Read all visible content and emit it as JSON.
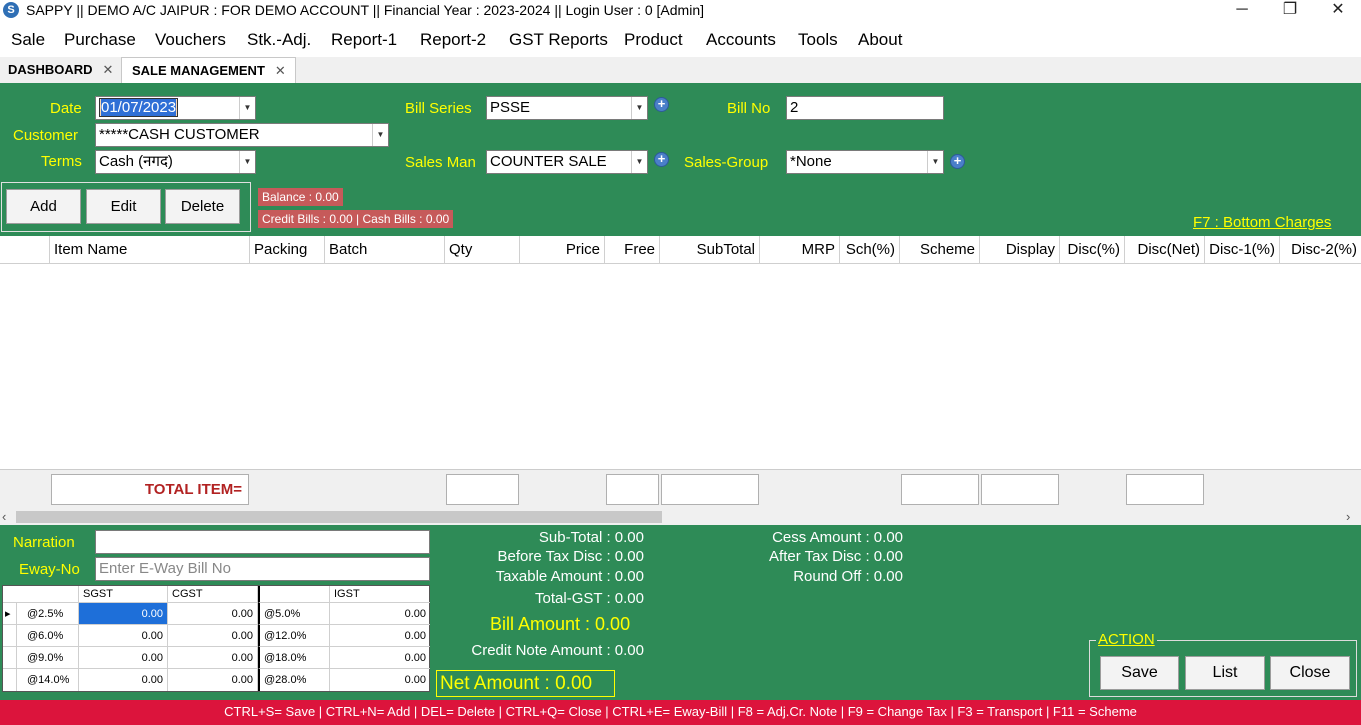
{
  "window": {
    "title": "SAPPY || DEMO A/C JAIPUR : FOR DEMO ACCOUNT || Financial Year : 2023-2024 || Login User : 0 [Admin]",
    "minimize": "─",
    "maximize": "❐",
    "close": "✕"
  },
  "menu": [
    "Sale",
    "Purchase",
    "Vouchers",
    "Stk.-Adj.",
    "Report-1",
    "Report-2",
    "GST Reports",
    "Product",
    "Accounts",
    "Tools",
    "About"
  ],
  "tabs": [
    {
      "label": "DASHBOARD",
      "close": "✕"
    },
    {
      "label": "SALE MANAGEMENT",
      "close": "✕"
    }
  ],
  "form": {
    "date_label": "Date",
    "date_value": "01/07/2023",
    "customer_label": "Customer",
    "customer_value": "*****CASH CUSTOMER",
    "terms_label": "Terms",
    "terms_value": "Cash (नगद)",
    "bill_series_label": "Bill Series",
    "bill_series_value": "PSSE",
    "sales_man_label": "Sales Man",
    "sales_man_value": "COUNTER SALE",
    "bill_no_label": "Bill No",
    "bill_no_value": "2",
    "sales_group_label": "Sales-Group",
    "sales_group_value": "*None"
  },
  "actions": {
    "add": "Add",
    "edit": "Edit",
    "delete": "Delete"
  },
  "balance": {
    "balance": "Balance : 0.00",
    "credit_cash": "Credit Bills : 0.00  | Cash Bills : 0.00"
  },
  "bottom_charges_link": "F7 : Bottom Charges",
  "grid": {
    "columns": [
      "",
      "Item Name",
      "Packing",
      "Batch",
      "Qty",
      "Price",
      "Free",
      "SubTotal",
      "MRP",
      "Sch(%)",
      "Scheme",
      "Display",
      "Disc(%)",
      "Disc(Net)",
      "Disc-1(%)",
      "Disc-2(%)"
    ],
    "total_item_label": "TOTAL ITEM="
  },
  "scroll": {
    "left": "‹",
    "right": "›"
  },
  "narration": {
    "label": "Narration",
    "value": ""
  },
  "eway": {
    "label": "Eway-No",
    "placeholder": "Enter E-Way Bill No"
  },
  "tax_table": {
    "headers": [
      "SGST",
      "CGST",
      "",
      "IGST"
    ],
    "rows": [
      {
        "marker": "▸",
        "rate": "@2.5%",
        "sgst": "0.00",
        "cgst": "0.00",
        "irate": "@5.0%",
        "igst": "0.00"
      },
      {
        "marker": "",
        "rate": "@6.0%",
        "sgst": "0.00",
        "cgst": "0.00",
        "irate": "@12.0%",
        "igst": "0.00"
      },
      {
        "marker": "",
        "rate": "@9.0%",
        "sgst": "0.00",
        "cgst": "0.00",
        "irate": "@18.0%",
        "igst": "0.00"
      },
      {
        "marker": "",
        "rate": "@14.0%",
        "sgst": "0.00",
        "cgst": "0.00",
        "irate": "@28.0%",
        "igst": "0.00"
      }
    ]
  },
  "summary": {
    "sub_total": "Sub-Total : 0.00",
    "before_tax_disc": "Before Tax Disc : 0.00",
    "taxable_amount": "Taxable Amount : 0.00",
    "total_gst": "Total-GST : 0.00",
    "bill_amount": "Bill Amount : 0.00",
    "credit_note_amount": "Credit Note Amount : 0.00",
    "net_amount": "Net Amount  : 0.00",
    "cess_amount": "Cess Amount : 0.00",
    "after_tax_disc": "After Tax Disc : 0.00",
    "round_off": "Round Off : 0.00"
  },
  "action_group": {
    "title": "ACTION",
    "save": "Save",
    "list": "List",
    "close": "Close"
  },
  "status": "CTRL+S= Save | CTRL+N= Add | DEL= Delete | CTRL+Q= Close | CTRL+E= Eway-Bill | F8 = Adj.Cr. Note | F9 = Change Tax | F3 = Transport | F11 = Scheme",
  "colors": {
    "green": "#2e8b57",
    "yellow": "#ffff00",
    "status_red": "#dc143c",
    "balance_red": "#c65a5a"
  }
}
